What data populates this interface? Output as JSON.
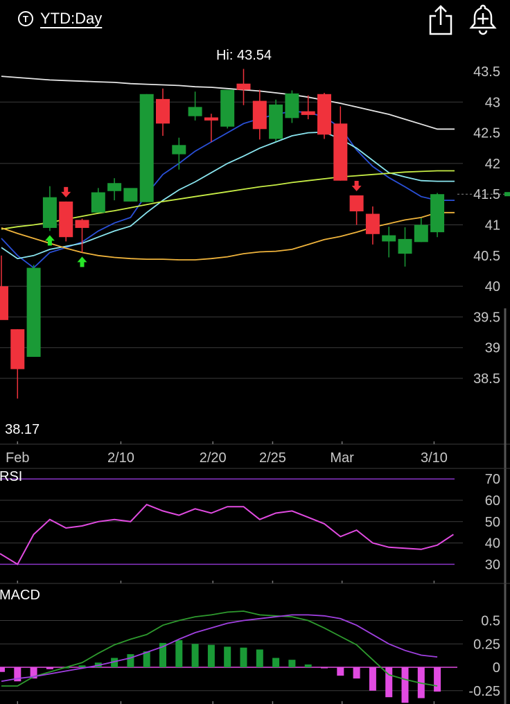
{
  "header": {
    "period_icon": "T",
    "period_label": "YTD:Day",
    "share_icon": "share-icon",
    "alert_icon": "add-alert-bell-icon"
  },
  "colors": {
    "up": "#1a9a36",
    "down": "#f0323c",
    "grid": "#3c3c3c",
    "ma_white": "#e6e6e6",
    "ma_blue": "#2a50d8",
    "ma_cyan": "#8ae6f0",
    "ma_lime": "#c8ee46",
    "ma_orange": "#f0b43c",
    "rsi": "#e14be1",
    "rsi_band": "#8a34c8",
    "macd_line": "#2e9a2e",
    "macd_signal": "#a040e0"
  },
  "chart_data": [
    {
      "type": "candlestick",
      "name": "price",
      "hi_label": "Hi: 43.54",
      "lo_label": ": 38.17",
      "x_tick_labels": [
        "Feb",
        "2/10",
        "2/20",
        "2/25",
        "Mar",
        "3/10"
      ],
      "y_tick_labels": [
        "43.5",
        "43",
        "42.5",
        "42",
        "41.5",
        "41",
        "40.5",
        "40",
        "39.5",
        "39",
        "38.5"
      ],
      "ylim": [
        37.8,
        44.1
      ],
      "last_price_marker": 41.5,
      "candles": [
        {
          "o": 40.0,
          "h": 40.5,
          "l": 39.6,
          "c": 39.45
        },
        {
          "o": 39.3,
          "h": 39.3,
          "l": 38.17,
          "c": 38.65
        },
        {
          "o": 38.85,
          "h": 40.35,
          "l": 38.85,
          "c": 40.3
        },
        {
          "o": 40.95,
          "h": 41.63,
          "l": 40.9,
          "c": 41.45
        },
        {
          "o": 41.38,
          "h": 41.38,
          "l": 40.73,
          "c": 40.8
        },
        {
          "o": 41.08,
          "h": 41.1,
          "l": 40.55,
          "c": 40.95
        },
        {
          "o": 41.2,
          "h": 41.6,
          "l": 41.2,
          "c": 41.53
        },
        {
          "o": 41.55,
          "h": 41.76,
          "l": 41.4,
          "c": 41.68
        },
        {
          "o": 41.38,
          "h": 41.58,
          "l": 41.38,
          "c": 41.6
        },
        {
          "o": 41.37,
          "h": 43.13,
          "l": 41.37,
          "c": 43.13
        },
        {
          "o": 43.05,
          "h": 43.22,
          "l": 42.45,
          "c": 42.65
        },
        {
          "o": 42.15,
          "h": 42.42,
          "l": 41.9,
          "c": 42.3
        },
        {
          "o": 42.77,
          "h": 43.17,
          "l": 42.7,
          "c": 42.92
        },
        {
          "o": 42.75,
          "h": 42.81,
          "l": 42.35,
          "c": 42.7
        },
        {
          "o": 42.6,
          "h": 43.19,
          "l": 42.57,
          "c": 43.2
        },
        {
          "o": 43.3,
          "h": 43.54,
          "l": 42.95,
          "c": 43.2
        },
        {
          "o": 43.02,
          "h": 43.2,
          "l": 42.39,
          "c": 42.56
        },
        {
          "o": 42.4,
          "h": 43.04,
          "l": 42.36,
          "c": 42.96
        },
        {
          "o": 42.74,
          "h": 43.19,
          "l": 42.66,
          "c": 43.14
        },
        {
          "o": 42.85,
          "h": 43.11,
          "l": 42.72,
          "c": 42.79
        },
        {
          "o": 43.13,
          "h": 43.15,
          "l": 42.4,
          "c": 42.47
        },
        {
          "o": 42.65,
          "h": 42.93,
          "l": 41.72,
          "c": 41.72
        },
        {
          "o": 41.48,
          "h": 41.48,
          "l": 41.0,
          "c": 41.22
        },
        {
          "o": 41.18,
          "h": 41.3,
          "l": 40.68,
          "c": 40.85
        },
        {
          "o": 40.73,
          "h": 40.97,
          "l": 40.47,
          "c": 40.83
        },
        {
          "o": 40.53,
          "h": 40.96,
          "l": 40.32,
          "c": 40.77
        },
        {
          "o": 40.72,
          "h": 41.11,
          "l": 40.72,
          "c": 41.0
        },
        {
          "o": 40.88,
          "h": 41.52,
          "l": 40.8,
          "c": 41.5
        }
      ],
      "series": [
        {
          "name": "",
          "color_key": "ma_white",
          "values": [
            43.42,
            43.4,
            43.38,
            43.36,
            43.35,
            43.34,
            43.33,
            43.32,
            43.3,
            43.29,
            43.28,
            43.27,
            43.25,
            43.24,
            43.22,
            43.2,
            43.18,
            43.15,
            43.12,
            43.08,
            43.03,
            42.98,
            42.92,
            42.86,
            42.8,
            42.72,
            42.64,
            42.56
          ]
        },
        {
          "name": "",
          "color_key": "ma_blue",
          "values": [
            40.78,
            40.5,
            40.3,
            40.55,
            40.63,
            40.72,
            40.9,
            41.03,
            41.12,
            41.5,
            41.82,
            42.0,
            42.2,
            42.35,
            42.5,
            42.65,
            42.73,
            42.8,
            42.85,
            42.83,
            42.76,
            42.58,
            42.22,
            41.95,
            41.77,
            41.62,
            41.46,
            41.4
          ]
        },
        {
          "name": "",
          "color_key": "ma_cyan",
          "values": [
            40.63,
            40.45,
            40.5,
            40.6,
            40.65,
            40.7,
            40.8,
            40.9,
            40.98,
            41.2,
            41.4,
            41.57,
            41.7,
            41.85,
            42.0,
            42.12,
            42.25,
            42.35,
            42.45,
            42.5,
            42.51,
            42.4,
            42.25,
            42.05,
            41.85,
            41.78,
            41.72,
            41.71
          ]
        },
        {
          "name": "",
          "color_key": "ma_lime",
          "values": [
            40.93,
            40.97,
            41.0,
            41.04,
            41.09,
            41.14,
            41.19,
            41.23,
            41.28,
            41.33,
            41.38,
            41.42,
            41.46,
            41.5,
            41.54,
            41.58,
            41.62,
            41.65,
            41.69,
            41.72,
            41.75,
            41.78,
            41.8,
            41.82,
            41.84,
            41.86,
            41.87,
            41.88
          ]
        },
        {
          "name": "",
          "color_key": "ma_orange",
          "values": [
            40.95,
            40.86,
            40.78,
            40.7,
            40.62,
            40.55,
            40.5,
            40.47,
            40.45,
            40.44,
            40.44,
            40.43,
            40.43,
            40.45,
            40.48,
            40.53,
            40.56,
            40.57,
            40.6,
            40.68,
            40.76,
            40.81,
            40.88,
            40.96,
            41.02,
            41.08,
            41.12,
            41.2
          ]
        }
      ],
      "buy_markers": [
        3,
        5
      ],
      "sell_markers": [
        4,
        22
      ]
    },
    {
      "type": "line",
      "name": "RSI",
      "label": "RSI",
      "y_tick_labels": [
        "70",
        "60",
        "50",
        "40",
        "30"
      ],
      "ylim": [
        25,
        72
      ],
      "bands": [
        70,
        30
      ],
      "values": [
        35,
        30,
        44,
        51,
        47,
        48,
        50,
        51,
        50,
        58,
        55,
        53,
        56,
        54,
        57,
        57,
        51,
        54,
        55,
        52,
        49,
        43,
        46,
        40,
        38,
        37.5,
        37,
        39,
        44
      ]
    },
    {
      "type": "bar+line",
      "name": "MACD",
      "label": "MACD",
      "y_tick_labels": [
        "0.5",
        "0.25",
        "0",
        "-0.25"
      ],
      "ylim": [
        -0.45,
        0.62
      ],
      "histogram": [
        -0.05,
        -0.15,
        -0.12,
        -0.02,
        0.0,
        0.02,
        0.05,
        0.1,
        0.14,
        0.17,
        0.26,
        0.29,
        0.25,
        0.24,
        0.22,
        0.21,
        0.19,
        0.1,
        0.08,
        0.03,
        -0.01,
        -0.09,
        -0.12,
        -0.25,
        -0.32,
        -0.38,
        -0.33,
        -0.26
      ],
      "macd": [
        -0.2,
        -0.2,
        -0.1,
        -0.05,
        0.0,
        0.05,
        0.15,
        0.24,
        0.3,
        0.35,
        0.45,
        0.5,
        0.54,
        0.56,
        0.59,
        0.6,
        0.56,
        0.55,
        0.54,
        0.5,
        0.42,
        0.33,
        0.24,
        0.08,
        -0.08,
        -0.13,
        -0.17,
        -0.2
      ],
      "signal": [
        -0.15,
        -0.12,
        -0.1,
        -0.07,
        -0.04,
        -0.01,
        0.02,
        0.06,
        0.1,
        0.16,
        0.22,
        0.3,
        0.37,
        0.42,
        0.47,
        0.5,
        0.52,
        0.54,
        0.56,
        0.56,
        0.55,
        0.52,
        0.45,
        0.35,
        0.25,
        0.18,
        0.13,
        0.11
      ]
    }
  ]
}
